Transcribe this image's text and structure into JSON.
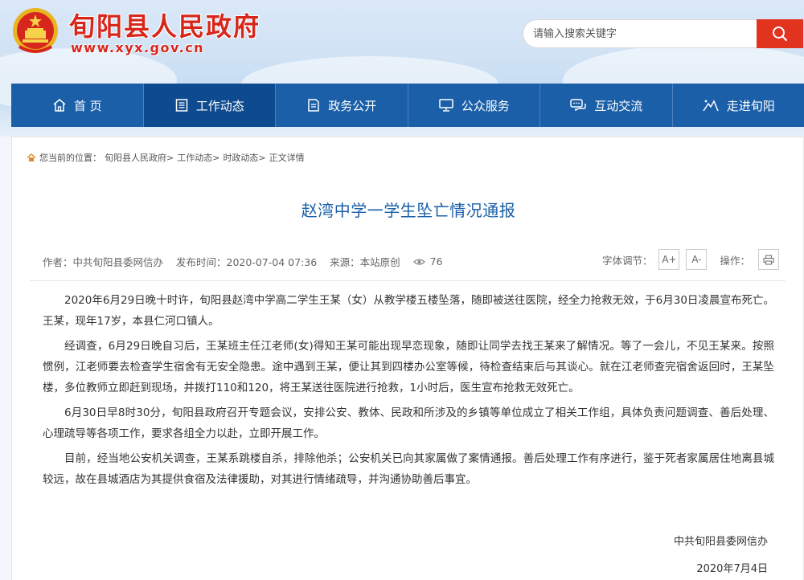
{
  "site": {
    "title": "旬阳县人民政府",
    "url": "www.xyx.gov.cn"
  },
  "search": {
    "placeholder": "请输入搜索关键字",
    "button_icon": "search-icon"
  },
  "nav": {
    "items": [
      {
        "label": "首 页",
        "icon": "home-icon"
      },
      {
        "label": "工作动态",
        "icon": "document-list-icon",
        "active": true
      },
      {
        "label": "政务公开",
        "icon": "file-icon"
      },
      {
        "label": "公众服务",
        "icon": "monitor-icon"
      },
      {
        "label": "互动交流",
        "icon": "chat-icon"
      },
      {
        "label": "走进旬阳",
        "icon": "mountain-icon"
      }
    ]
  },
  "breadcrumb": {
    "prefix": "您当前的位置：",
    "items": [
      "旬阳县人民政府>",
      "工作动态>",
      "时政动态>",
      "正文详情"
    ]
  },
  "article": {
    "title": "赵湾中学一学生坠亡情况通报",
    "author": "作者：中共旬阳县委网信办",
    "published": "发布时间：2020-07-04 07:36",
    "source": "来源：本站原创",
    "views": "76",
    "paragraphs": [
      "2020年6月29日晚十时许，旬阳县赵湾中学高二学生王某（女）从教学楼五楼坠落，随即被送往医院，经全力抢救无效，于6月30日凌晨宣布死亡。王某，现年17岁，本县仁河口镇人。",
      "经调查，6月29日晚自习后，王某班主任江老师(女)得知王某可能出现早恋现象，随即让同学去找王某来了解情况。等了一会儿，不见王某来。按照惯例，江老师要去检查学生宿舍有无安全隐患。途中遇到王某，便让其到四楼办公室等候，待检查结束后与其谈心。就在江老师查完宿舍返回时，王某坠楼，多位教师立即赶到现场，并拨打110和120，将王某送往医院进行抢救，1小时后，医生宣布抢救无效死亡。",
      "6月30日早8时30分，旬阳县政府召开专题会议，安排公安、教体、民政和所涉及的乡镇等单位成立了相关工作组，具体负责问题调查、善后处理、心理疏导等各项工作，要求各组全力以赴，立即开展工作。",
      "目前，经当地公安机关调查，王某系跳楼自杀，排除他杀；公安机关已向其家属做了案情通报。善后处理工作有序进行，鉴于死者家属居住地离县城较远，故在县城酒店为其提供食宿及法律援助，对其进行情绪疏导，并沟通协助善后事宜。"
    ],
    "signature": "中共旬阳县委网信办",
    "date": "2020年7月4日"
  },
  "tools": {
    "font_label": "字体调节：",
    "font_increase": "A+",
    "font_decrease": "A-",
    "action_label": "操作：",
    "print_icon": "printer-icon"
  },
  "colors": {
    "brand_red": "#d7271c",
    "nav_blue": "#1a5fa8",
    "nav_active": "#0e4a8f",
    "search_red": "#e2331f"
  }
}
